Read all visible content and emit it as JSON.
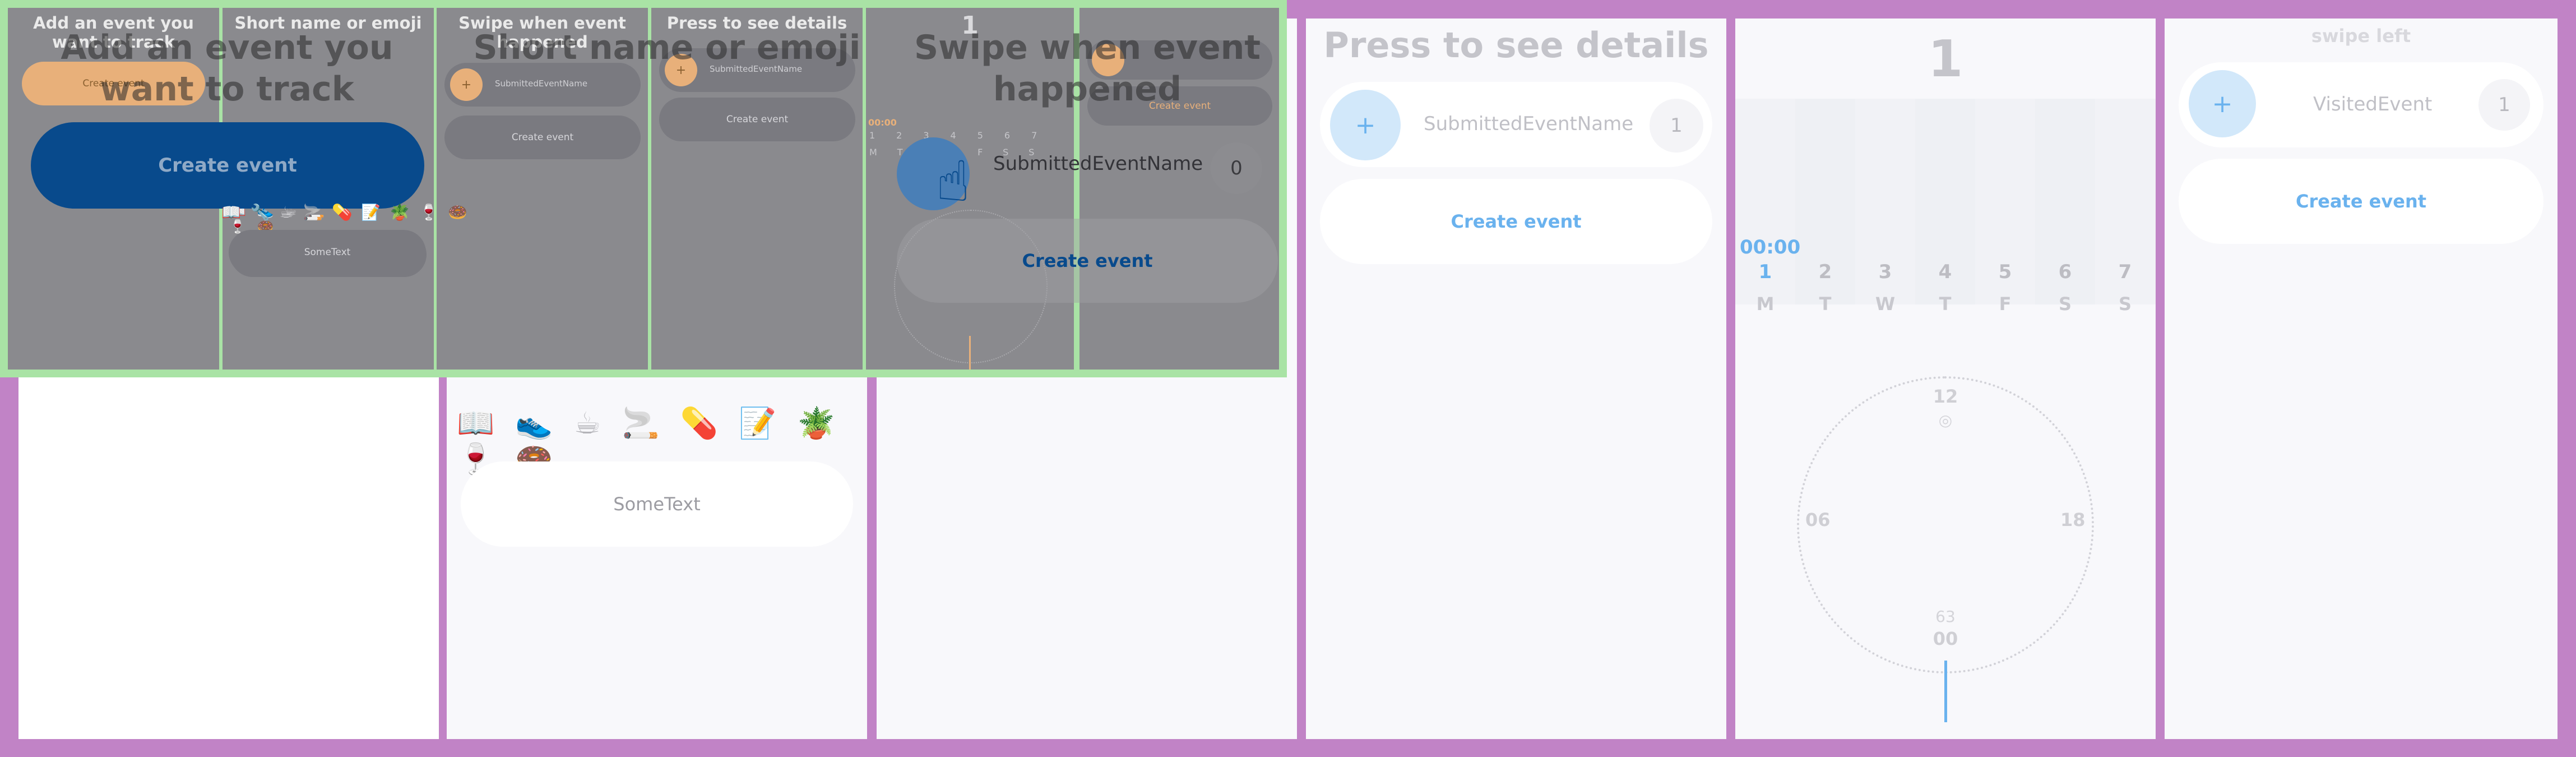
{
  "screens": {
    "s1": {
      "title": "Add an event you want to track",
      "button": "Create event"
    },
    "s2": {
      "title": "Short name or emoji",
      "emoji": [
        "📖",
        "👟",
        "☕",
        "🚬",
        "💊",
        "📝",
        "🪴",
        "🍷",
        "🍩"
      ],
      "input_value": "SomeText"
    },
    "s3": {
      "title": "Swipe when event happened",
      "event_name": "SubmittedEventName",
      "count": "0",
      "button": "Create event"
    },
    "s4": {
      "title": "Press to see details",
      "event_name": "SubmittedEventName",
      "count": "1",
      "plus": "+",
      "button": "Create event"
    },
    "s5": {
      "day": "1",
      "time": "00:00",
      "days": [
        "1",
        "2",
        "3",
        "4",
        "5",
        "6",
        "7"
      ],
      "letters": [
        "M",
        "T",
        "W",
        "T",
        "F",
        "S",
        "S"
      ],
      "clock": {
        "top": "12",
        "left": "06",
        "right": "18",
        "bottom": "00",
        "inner_bottom": "63"
      }
    },
    "s6": {
      "hint": "swipe left",
      "event_name": "VisitedEvent",
      "count": "1",
      "plus": "+",
      "button": "Create event"
    }
  },
  "colors": {
    "background": "#c183c6",
    "accent_blue": "#6ab2ee",
    "dark_blue": "#084a8c",
    "orange": "#e8b07a",
    "overlay_green": "#a9e3a5"
  }
}
